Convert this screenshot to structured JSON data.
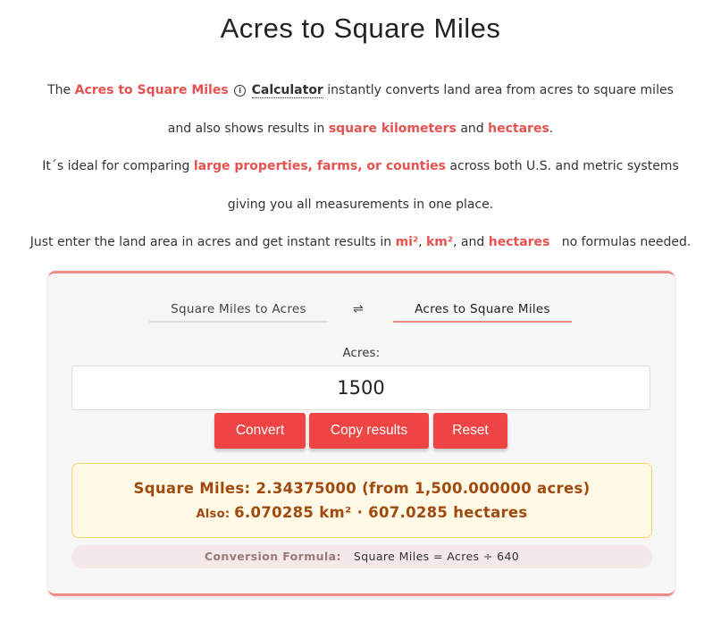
{
  "page": {
    "title": "Acres to Square Miles"
  },
  "intro": {
    "line1": {
      "pre": "The ",
      "link": "Acres to Square Miles",
      "info_icon": "info-circle-icon",
      "calc": "Calculator",
      "post": " instantly converts land area from acres to square miles"
    },
    "line2": {
      "pre": "and also shows results in ",
      "hl1": "square kilometers",
      "mid": " and ",
      "hl2": "hectares",
      "post": "."
    },
    "line3": {
      "pre": "It´s ideal for comparing ",
      "hl": "large properties, farms, or counties",
      "post": " across both U.S. and metric systems"
    },
    "line4": "giving you all measurements in one place.",
    "line5": {
      "pre": "Just enter the land area in acres and get instant results in ",
      "hl1": "mi²",
      "sep1": ", ",
      "hl2": "km²",
      "sep2": ", and ",
      "hl3": "hectares",
      "post": "   no formulas needed."
    }
  },
  "calculator": {
    "tabs": {
      "left": "Square Miles to Acres",
      "swap_icon": "⇌",
      "right": "Acres to Square Miles"
    },
    "input": {
      "label": "Acres:",
      "value": "1500"
    },
    "buttons": {
      "convert": "Convert",
      "copy": "Copy results",
      "reset": "Reset"
    },
    "result": {
      "main": "Square Miles: 2.34375000 (from 1,500.000000 acres)",
      "also_label": "Also: ",
      "also_value": "6.070285 km² · 607.0285 hectares"
    },
    "formula": {
      "label": "Conversion Formula:",
      "text": "Square Miles = Acres ÷ 640"
    }
  },
  "colors": {
    "accent": "#e5524f",
    "button": "#ef4444",
    "result_bg": "#fff9e6",
    "result_text": "#a04a10"
  }
}
